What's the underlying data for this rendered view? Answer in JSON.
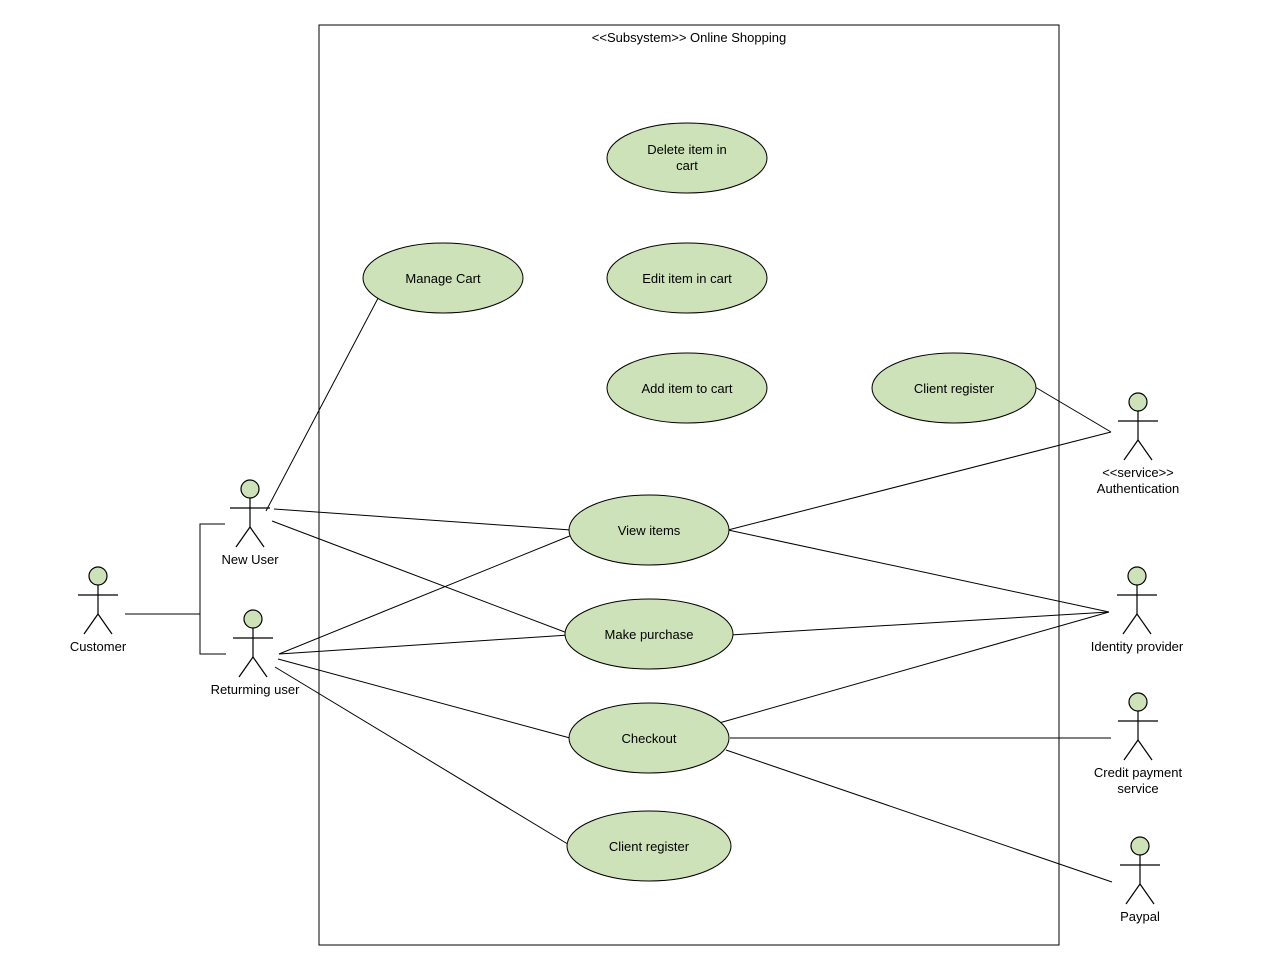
{
  "subsystem": {
    "title": "<<Subsystem>> Online Shopping"
  },
  "actors": {
    "customer": "Customer",
    "newUser": "New User",
    "returningUser": "Returming user",
    "authentication": {
      "stereotype": "<<service>>",
      "name": "Authentication"
    },
    "identityProvider": "Identity provider",
    "creditPayment": {
      "line1": "Credit payment",
      "line2": "service"
    },
    "paypal": "Paypal"
  },
  "usecases": {
    "manageCart": "Manage Cart",
    "deleteItem": {
      "line1": "Delete item in",
      "line2": "cart"
    },
    "editItem": "Edit item in cart",
    "addItem": "Add item to cart",
    "clientRegisterTop": "Client register",
    "viewItems": "View items",
    "makePurchase": "Make purchase",
    "checkout": "Checkout",
    "clientRegisterBottom": "Client register"
  }
}
